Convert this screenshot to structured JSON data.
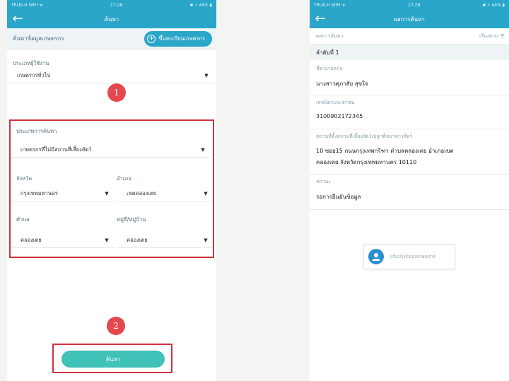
{
  "left": {
    "status": {
      "carrier": "TRUE-H WIFI ᯤ",
      "time": "17:28",
      "battery": "✱ ⚡ 44% ▮"
    },
    "nav": {
      "title": "ค้นหา"
    },
    "header": {
      "title": "ค้นหาข้อมูลเกษตรกร",
      "register_label": "ขึ้นทะเบียนเกษตรกร"
    },
    "fields": {
      "user_type_label": "ประเภทผู้ใช้งาน",
      "user_type_value": "เกษตรกรทั่วไป",
      "search_type_label": "ประเภทการค้นหา",
      "search_type_value": "เกษตรกรที่ไม่มีสถานที่เลี้ยงสัตว์",
      "province_label": "จังหวัด",
      "province_value": "กรุงเทพมหานคร",
      "district_label": "อำเภอ",
      "district_value": "เขตคลองเตย",
      "subdistrict_label": "ตำบล",
      "subdistrict_value": "คลองเตย",
      "village_label": "หมู่ที่/หมู่บ้าน",
      "village_value": "คลองเตย"
    },
    "markers": {
      "one": "1",
      "two": "2"
    },
    "search_button": "ค้นหา"
  },
  "right": {
    "status": {
      "carrier": "TRUE-H WIFI ᯤ",
      "time": "17:28",
      "battery": "✱ ⚡ 44% ▮"
    },
    "nav": {
      "title": "ผลการค้นหา"
    },
    "header": {
      "title": "ผลการค้นหา",
      "sort_label": "เรียงตาม"
    },
    "result": {
      "order": "ลำดับที่ 1",
      "name_label": "ชื่อ-นามสกุล",
      "name_value": "นางสาวศุภาสัย สุขใจ",
      "id_label": "เลขบัตรประชาชน",
      "id_value": "3100902172345",
      "address_label": "สถานที่ตั้งสถานที่เลี้ยงสัตว์/ปลูกพืชอาหารสัตว์",
      "address_line1": "10 ซอย15 ถนนกรุงเทพกรีฑา ตำบลคลองเตย อำเภอเขต",
      "address_line2": "คลองเตย จังหวัดกรุงเทพมหานคร 10110",
      "status_label": "สถานะ",
      "status_value": "รอการยืนยันข้อมูล",
      "update_label": "ปรับปรุงข้อมูลเกษตรกร"
    }
  },
  "colors": {
    "primary": "#29a6c9",
    "highlight": "#d1323d",
    "marker": "#e4484e",
    "button": "#40c2b8"
  },
  "icons": {
    "back": "back-arrow-icon",
    "plus": "plus-circle-icon",
    "caret": "caret-down-icon",
    "sort": "sort-icon",
    "user": "user-icon"
  }
}
